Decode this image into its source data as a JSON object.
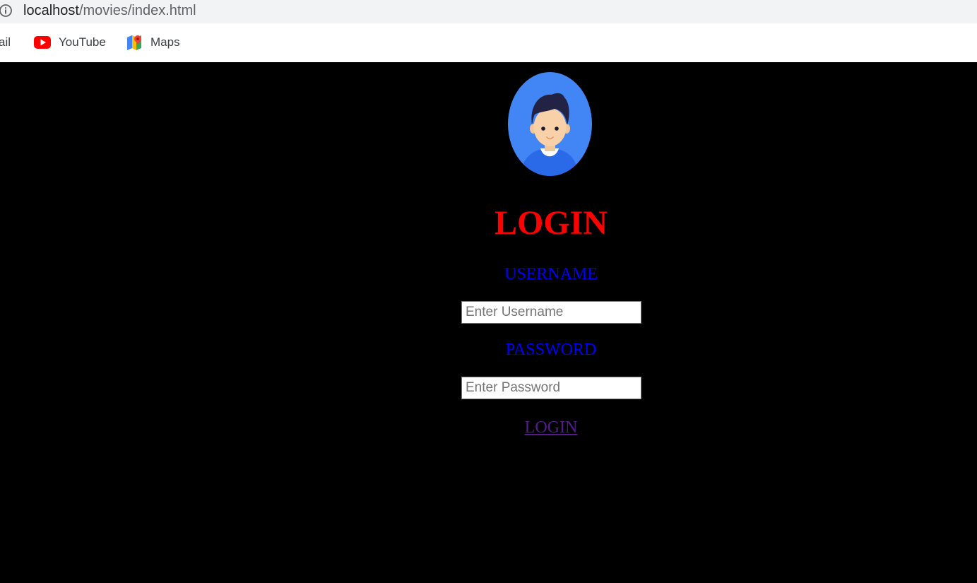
{
  "browser": {
    "url_host": "localhost",
    "url_path": "/movies/index.html",
    "bookmarks": [
      {
        "label": "ail",
        "icon": "gmail-icon"
      },
      {
        "label": "YouTube",
        "icon": "youtube-icon"
      },
      {
        "label": "Maps",
        "icon": "maps-icon"
      }
    ]
  },
  "login": {
    "title": "LOGIN",
    "username_label": "USERNAME",
    "username_placeholder": "Enter Username",
    "password_label": "PASSWORD",
    "password_placeholder": "Enter Password",
    "submit_label": "LOGIN"
  },
  "colors": {
    "background": "#000000",
    "title": "#ff0000",
    "labels": "#0000ff",
    "link_visited": "#551a8b",
    "avatar_bg": "#4285f4"
  }
}
